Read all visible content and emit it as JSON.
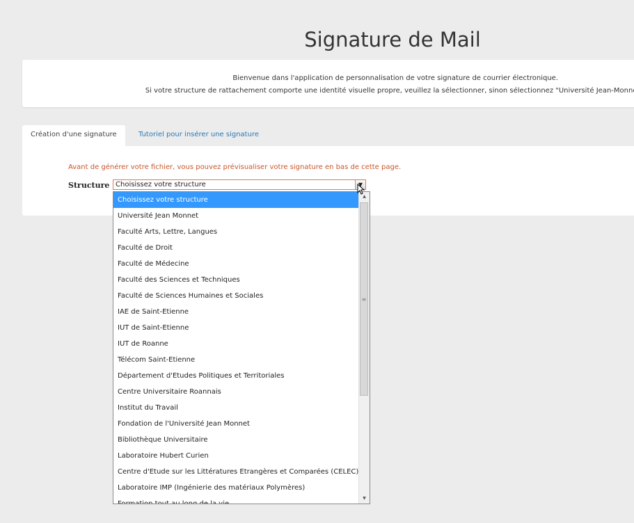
{
  "page": {
    "title": "Signature de Mail"
  },
  "welcome": {
    "line1": "Bienvenue dans l'application de personnalisation de votre signature de courrier électronique.",
    "line2": "Si votre structure de rattachement comporte une identité visuelle propre, veuillez la sélectionner, sinon sélectionnez \"Université Jean-Monnet\""
  },
  "tabs": [
    {
      "label": "Création d'une signature",
      "active": true
    },
    {
      "label": "Tutoriel pour insérer une signature",
      "active": false
    }
  ],
  "form": {
    "preview_note": "Avant de générer votre fichier, vous pouvez prévisualiser votre signature en bas de cette page.",
    "structure_label": "Structure :",
    "structure_value": "Choisissez votre structure"
  },
  "dropdown": {
    "options": [
      "Choisissez votre structure",
      "Université Jean Monnet",
      "Faculté Arts, Lettre, Langues",
      "Faculté de Droit",
      "Faculté de Médecine",
      "Faculté des Sciences et Techniques",
      "Faculté de Sciences Humaines et Sociales",
      "IAE de Saint-Etienne",
      "IUT de Saint-Etienne",
      "IUT de Roanne",
      "Télécom Saint-Etienne",
      "Département d'Etudes Politiques et Territoriales",
      "Centre Universitaire Roannais",
      "Institut du Travail",
      "Fondation de l'Université Jean Monnet",
      "Bibliothèque Universitaire",
      "Laboratoire Hubert Curien",
      "Centre d'Etude sur les Littératures Etrangères et Comparées (CELEC)",
      "Laboratoire IMP (Ingénierie des matériaux Polymères)",
      "Formation tout au long de la vie"
    ],
    "selected_index": 0
  },
  "colors": {
    "background": "#ececec",
    "link": "#2a7ab8",
    "note": "#c8562a",
    "highlight": "#3399ff"
  },
  "icons": {
    "select_arrow": "chevron-down-icon",
    "scroll_up": "arrow-up-icon",
    "scroll_down": "arrow-down-icon",
    "cursor": "mouse-pointer-icon"
  }
}
